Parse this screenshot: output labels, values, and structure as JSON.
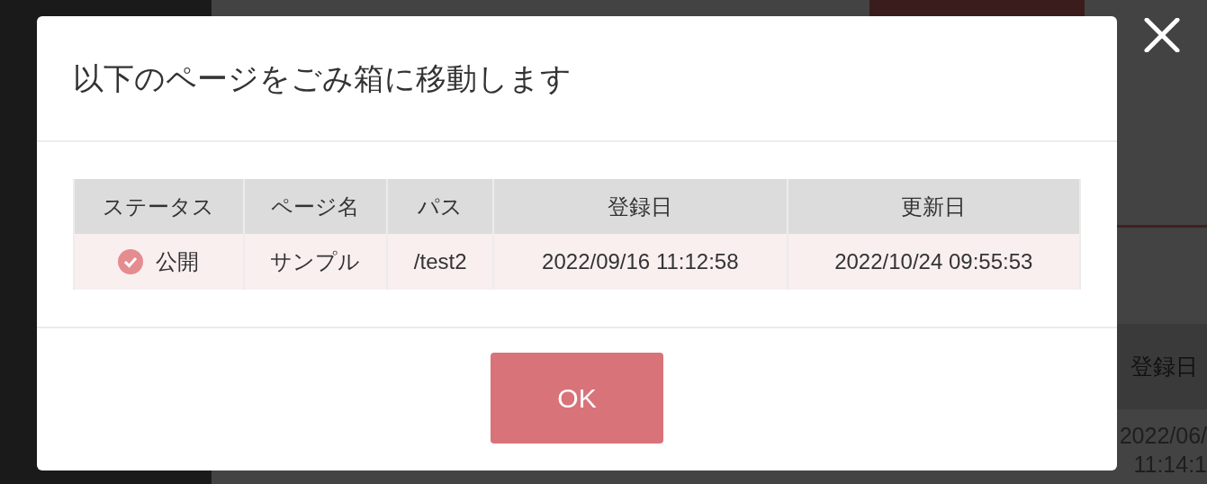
{
  "background": {
    "table": {
      "column_header": "登録日",
      "cell_lines": [
        "2022/06/",
        "11:14:1"
      ]
    }
  },
  "dialog": {
    "title": "以下のページをごみ箱に移動します",
    "table": {
      "columns": [
        "ステータス",
        "ページ名",
        "パス",
        "登録日",
        "更新日"
      ],
      "rows": [
        {
          "status": "公開",
          "published": true,
          "page_name": "サンプル",
          "path": "/test2",
          "created": "2022/09/16 11:12:58",
          "updated": "2022/10/24 09:55:53"
        }
      ]
    },
    "ok_button": "OK"
  }
}
